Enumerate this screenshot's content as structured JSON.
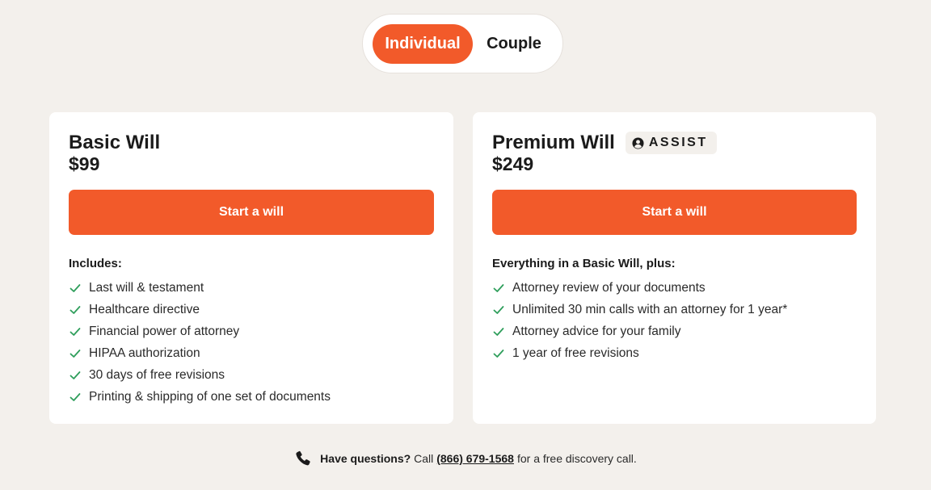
{
  "plan_toggle": {
    "options": [
      {
        "label": "Individual",
        "selected": true
      },
      {
        "label": "Couple",
        "selected": false
      }
    ]
  },
  "colors": {
    "accent": "#f25a2a",
    "background": "#f3f0ec",
    "check": "#2e9e5b"
  },
  "plans": [
    {
      "title": "Basic Will",
      "price": "$99",
      "cta_label": "Start a will",
      "list_heading": "Includes:",
      "features": [
        "Last will & testament",
        "Healthcare directive",
        "Financial power of attorney",
        "HIPAA authorization",
        "30 days of free revisions",
        "Printing & shipping of one set of documents"
      ]
    },
    {
      "title": "Premium Will",
      "badge": {
        "icon": "user-circle-icon",
        "label": "ASSIST"
      },
      "price": "$249",
      "cta_label": "Start a will",
      "list_heading": "Everything in a Basic Will, plus:",
      "features": [
        "Attorney review of your documents",
        "Unlimited 30 min calls with an attorney for 1 year*",
        "Attorney advice for your family",
        "1 year of free revisions"
      ]
    }
  ],
  "footer": {
    "icon": "phone-icon",
    "question": "Have questions?",
    "call_text": "Call",
    "phone": "(866) 679-1568",
    "tail": "for a free discovery call."
  }
}
